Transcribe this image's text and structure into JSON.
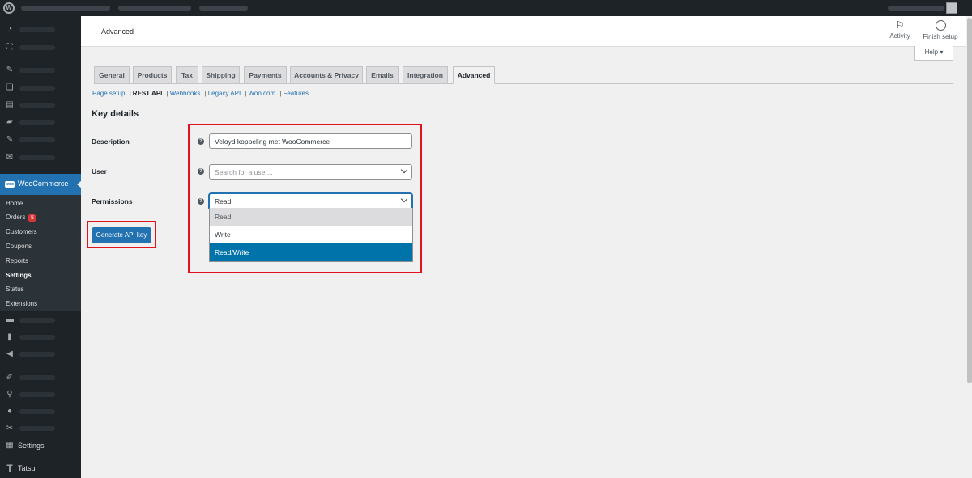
{
  "header": {
    "page_title": "Advanced",
    "activity_label": "Activity",
    "finish_setup_label": "Finish setup",
    "help_label": "Help ▾"
  },
  "sidebar": {
    "woocommerce_label": "WooCommerce",
    "submenu": [
      {
        "label": "Home"
      },
      {
        "label": "Orders",
        "badge": "5"
      },
      {
        "label": "Customers"
      },
      {
        "label": "Coupons"
      },
      {
        "label": "Reports"
      },
      {
        "label": "Settings",
        "active": true
      },
      {
        "label": "Status"
      },
      {
        "label": "Extensions"
      }
    ],
    "settings_label": "Settings",
    "tatsu_label": "Tatsu"
  },
  "tabs": [
    {
      "label": "General"
    },
    {
      "label": "Products"
    },
    {
      "label": "Tax"
    },
    {
      "label": "Shipping"
    },
    {
      "label": "Payments"
    },
    {
      "label": "Accounts & Privacy"
    },
    {
      "label": "Emails"
    },
    {
      "label": "Integration"
    },
    {
      "label": "Advanced",
      "active": true
    }
  ],
  "subnav": {
    "page_setup": "Page setup",
    "rest_api": "REST API",
    "webhooks": "Webhooks",
    "legacy_api": "Legacy API",
    "woo_com": "Woo.com",
    "features": "Features",
    "separator": "|"
  },
  "form": {
    "section_title": "Key details",
    "description_label": "Description",
    "description_value": "Veloyd koppeling met WooCommerce",
    "user_label": "User",
    "user_placeholder": "Search for a user...",
    "permissions_label": "Permissions",
    "permissions_value": "Read",
    "permission_options": [
      {
        "label": "Read",
        "state": "hover"
      },
      {
        "label": "Write",
        "state": "normal"
      },
      {
        "label": "Read/Write",
        "state": "selected"
      }
    ],
    "generate_button": "Generate API key"
  },
  "colors": {
    "accent": "#2271b1",
    "highlight_box": "#e0141e",
    "sidebar": "#1d2327"
  }
}
